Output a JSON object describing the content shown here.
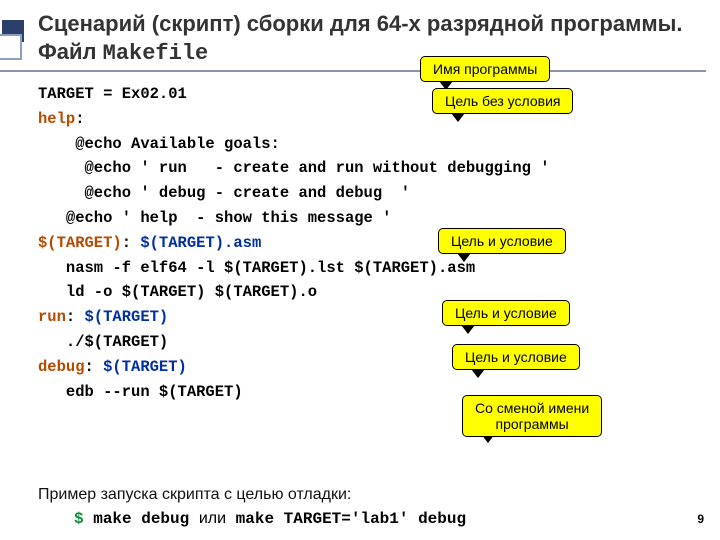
{
  "title": {
    "part1": "Сценарий (скрипт) сборки для 64-х разрядной программы. Файл ",
    "filename": "Makefile"
  },
  "code": {
    "l1": "TARGET = Ex02.01",
    "l2a": "help",
    "l2b": ":",
    "l3": "    @echo Available goals:",
    "l4": "     @echo ' run   - create and run without debugging '",
    "l5": "     @echo ' debug - create and debug  '",
    "l6": "   @echo ' help  - show this message '",
    "l7a": "$(TARGET)",
    "l7b": ": ",
    "l7c": "$(TARGET).asm",
    "l8": "   nasm -f elf64 -l $(TARGET).lst $(TARGET).asm",
    "l9": "   ld -o $(TARGET) $(TARGET).o",
    "l10a": "run",
    "l10b": ": ",
    "l10c": "$(TARGET)",
    "l11": "   ./$(TARGET)",
    "l12a": "debug",
    "l12b": ": ",
    "l12c": "$(TARGET)",
    "l13": "   edb --run $(TARGET)"
  },
  "footer": "Пример запуска скрипта с целью отладки:",
  "cmd": {
    "dollar": "$",
    "a": " make debug ",
    "or": "или",
    "b": " make TARGET='lab1' debug"
  },
  "callouts": {
    "c1": "Имя программы",
    "c2": "Цель без условия",
    "c3": "Цель и условие",
    "c4": "Цель и условие",
    "c5": "Цель и условие",
    "c6a": "Со сменой имени",
    "c6b": "программы"
  },
  "pagenum": "9"
}
